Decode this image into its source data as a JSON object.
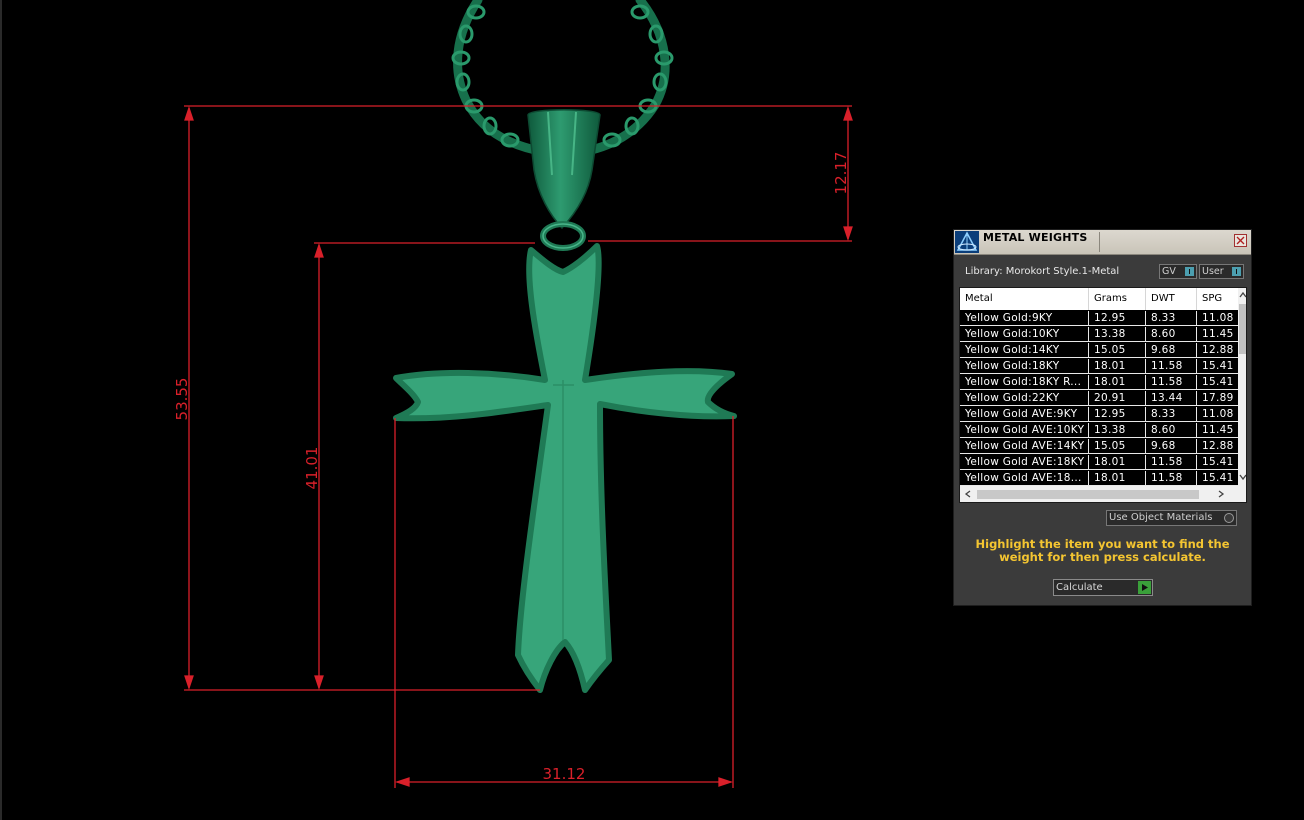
{
  "viewport": {
    "dimensions": {
      "total_height": "53.55",
      "cross_height": "41.01",
      "bail_height": "12.17",
      "width": "31.12"
    }
  },
  "colors": {
    "background": "#000000",
    "model_fill": "#37a57a",
    "model_edge": "#1f7a55",
    "dimension": "#d9202a",
    "panel_bg": "#3b3b3b",
    "instruction_text": "#f4c531",
    "calculate_go": "#3aa03a"
  },
  "panel": {
    "title": "METAL WEIGHTS",
    "library_label": "Library: Morokort Style.1-Metal",
    "toggles": {
      "gv": "GV",
      "user": "User"
    },
    "table": {
      "columns": [
        "Metal",
        "Grams",
        "DWT",
        "SPG"
      ],
      "rows": [
        [
          "Yellow Gold:9KY",
          "12.95",
          "8.33",
          "11.08"
        ],
        [
          "Yellow Gold:10KY",
          "13.38",
          "8.60",
          "11.45"
        ],
        [
          "Yellow Gold:14KY",
          "15.05",
          "9.68",
          "12.88"
        ],
        [
          "Yellow Gold:18KY",
          "18.01",
          "11.58",
          "15.41"
        ],
        [
          "Yellow Gold:18KY R...",
          "18.01",
          "11.58",
          "15.41"
        ],
        [
          "Yellow Gold:22KY",
          "20.91",
          "13.44",
          "17.89"
        ],
        [
          "Yellow Gold AVE:9KY",
          "12.95",
          "8.33",
          "11.08"
        ],
        [
          "Yellow Gold AVE:10KY",
          "13.38",
          "8.60",
          "11.45"
        ],
        [
          "Yellow Gold AVE:14KY",
          "15.05",
          "9.68",
          "12.88"
        ],
        [
          "Yellow Gold AVE:18KY",
          "18.01",
          "11.58",
          "15.41"
        ],
        [
          "Yellow Gold AVE:18...",
          "18.01",
          "11.58",
          "15.41"
        ]
      ]
    },
    "use_object_materials": "Use Object Materials",
    "instruction": "Highlight the item you want to find the weight for then press calculate.",
    "calculate_label": "Calculate"
  }
}
